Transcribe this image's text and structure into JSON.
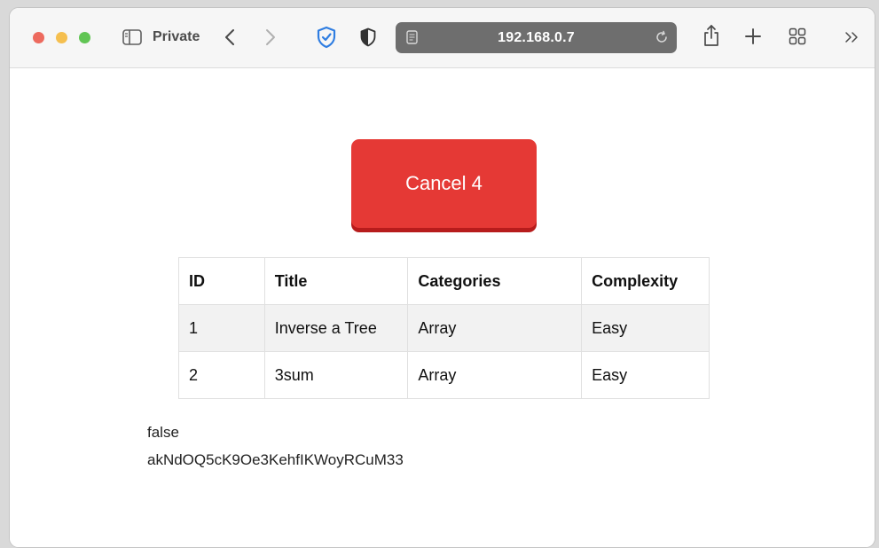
{
  "browser": {
    "mode_label": "Private",
    "address": "192.168.0.7",
    "icons": [
      "sidebar-icon",
      "back-icon",
      "forward-icon",
      "shield-check-icon",
      "shield-half-icon",
      "page-icon",
      "reload-icon",
      "share-icon",
      "plus-icon",
      "tab-overview-icon",
      "overflow-icon"
    ],
    "colors": {
      "close": "#ed6a5e",
      "minimize": "#f5bf4f",
      "zoom": "#61c554"
    }
  },
  "page": {
    "cancel_button": {
      "label": "Cancel 4",
      "color": "#e53935"
    },
    "table": {
      "headers": [
        "ID",
        "Title",
        "Categories",
        "Complexity"
      ],
      "rows": [
        [
          "1",
          "Inverse a Tree",
          "Array",
          "Easy"
        ],
        [
          "2",
          "3sum",
          "Array",
          "Easy"
        ]
      ]
    },
    "status_text": "false",
    "token_text": "akNdOQ5cK9Oe3KehfIKWoyRCuM33"
  }
}
